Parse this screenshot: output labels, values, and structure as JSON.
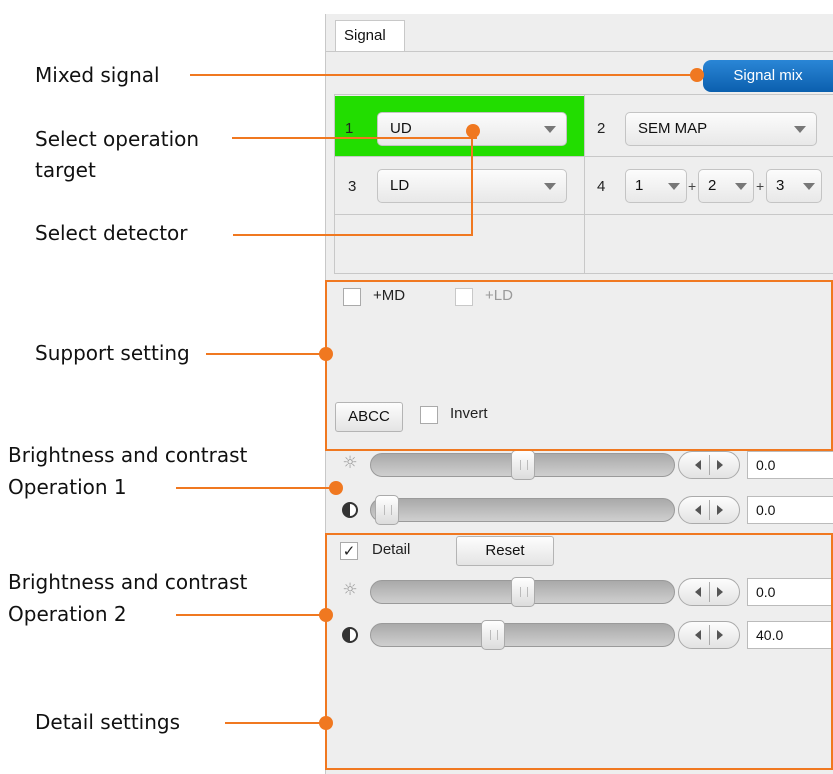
{
  "annotations": {
    "mixed_signal": "Mixed signal",
    "select_target_1": "Select operation",
    "select_target_2": "target",
    "select_detector": "Select detector",
    "support_setting": "Support setting",
    "bc1_line1": "Brightness and contrast",
    "bc1_line2": "Operation 1",
    "bc2_line1": "Brightness and contrast",
    "bc2_line2": "Operation 2",
    "detail_settings": "Detail settings"
  },
  "tab": {
    "label": "Signal"
  },
  "signal_mix_button": "Signal mix",
  "slots": [
    {
      "number": "1",
      "value": "UD",
      "selected": true
    },
    {
      "number": "2",
      "value": "SEM MAP"
    },
    {
      "number": "3",
      "value": "LD"
    },
    {
      "number": "4",
      "mix": [
        "1",
        "2",
        "3"
      ],
      "plus": "+"
    }
  ],
  "support": {
    "md_label": "+MD",
    "md_checked": false,
    "ld_label": "+LD",
    "ld_checked": false,
    "ld_enabled": false,
    "abcc_button": "ABCC",
    "invert_label": "Invert",
    "invert_checked": false
  },
  "operation1": {
    "brightness": {
      "icon": "brightness-icon",
      "value": "0.0",
      "slider_fraction": 0.5
    },
    "contrast": {
      "icon": "contrast-icon",
      "value": "0.0",
      "slider_fraction": 0.0
    }
  },
  "detail": {
    "label": "Detail",
    "checked": true,
    "check_mark": "✓",
    "reset_button": "Reset"
  },
  "operation2": {
    "brightness": {
      "icon": "brightness-icon",
      "value": "0.0",
      "slider_fraction": 0.5
    },
    "contrast": {
      "icon": "contrast-icon",
      "value": "40.0",
      "slider_fraction": 0.4
    }
  },
  "colors": {
    "annotation": "#f07820",
    "selected_slot": "#22dd00",
    "signal_mix": "#1a72c4"
  }
}
